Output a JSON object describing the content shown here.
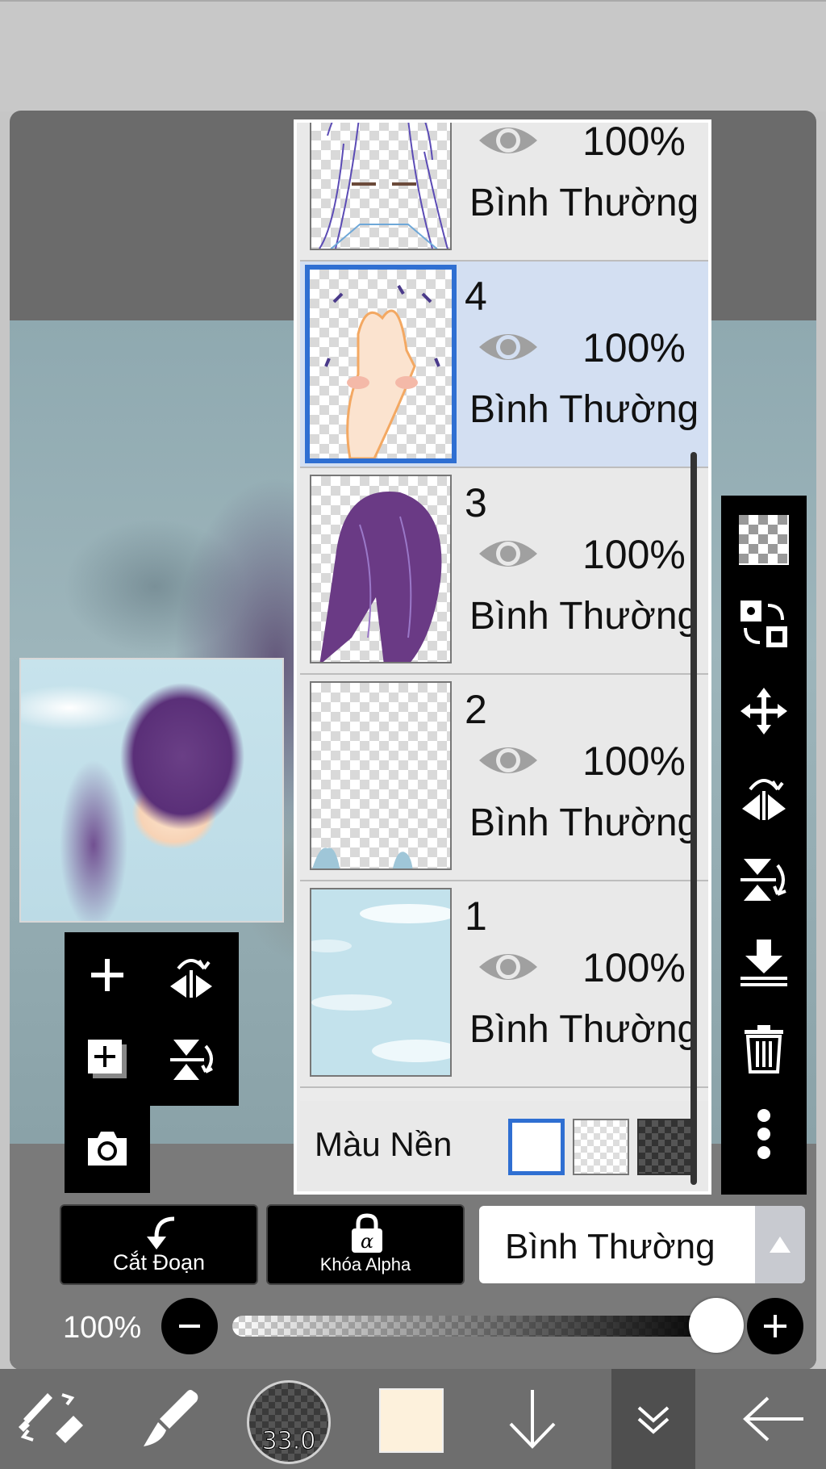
{
  "layers": [
    {
      "number": "",
      "opacity": "100%",
      "blend_mode": "Bình Thường",
      "visible": true,
      "selected": false
    },
    {
      "number": "4",
      "opacity": "100%",
      "blend_mode": "Bình Thường",
      "visible": true,
      "selected": true
    },
    {
      "number": "3",
      "opacity": "100%",
      "blend_mode": "Bình Thường",
      "visible": true,
      "selected": false
    },
    {
      "number": "2",
      "opacity": "100%",
      "blend_mode": "Bình Thường",
      "visible": true,
      "selected": false
    },
    {
      "number": "1",
      "opacity": "100%",
      "blend_mode": "Bình Thường",
      "visible": true,
      "selected": false
    }
  ],
  "background_color": {
    "label": "Màu Nền",
    "options": [
      "white",
      "transparent",
      "dark-checker"
    ],
    "selected": "white"
  },
  "actions": {
    "clipping_label": "Cắt Đoạn",
    "alpha_lock_label": "Khóa Alpha",
    "blend_mode_value": "Bình Thường"
  },
  "opacity": {
    "value_label": "100%",
    "level": 1.0
  },
  "brush": {
    "size": "33.0"
  },
  "colors": {
    "selection_accent": "#2f6fd2",
    "selected_row": "#d3dff2",
    "current_color": "#fdf1dc"
  },
  "right_tools": [
    "transparent-checker-icon",
    "swap-layers-icon",
    "move-icon",
    "flip-horizontal-icon",
    "flip-vertical-icon",
    "merge-down-icon",
    "trash-icon",
    "more-icon"
  ],
  "bottom_nav": [
    "tool-switch-icon",
    "brush-icon",
    "brush-size",
    "color-swatch",
    "download-arrow-icon",
    "layers-icon",
    "back-arrow-icon"
  ]
}
